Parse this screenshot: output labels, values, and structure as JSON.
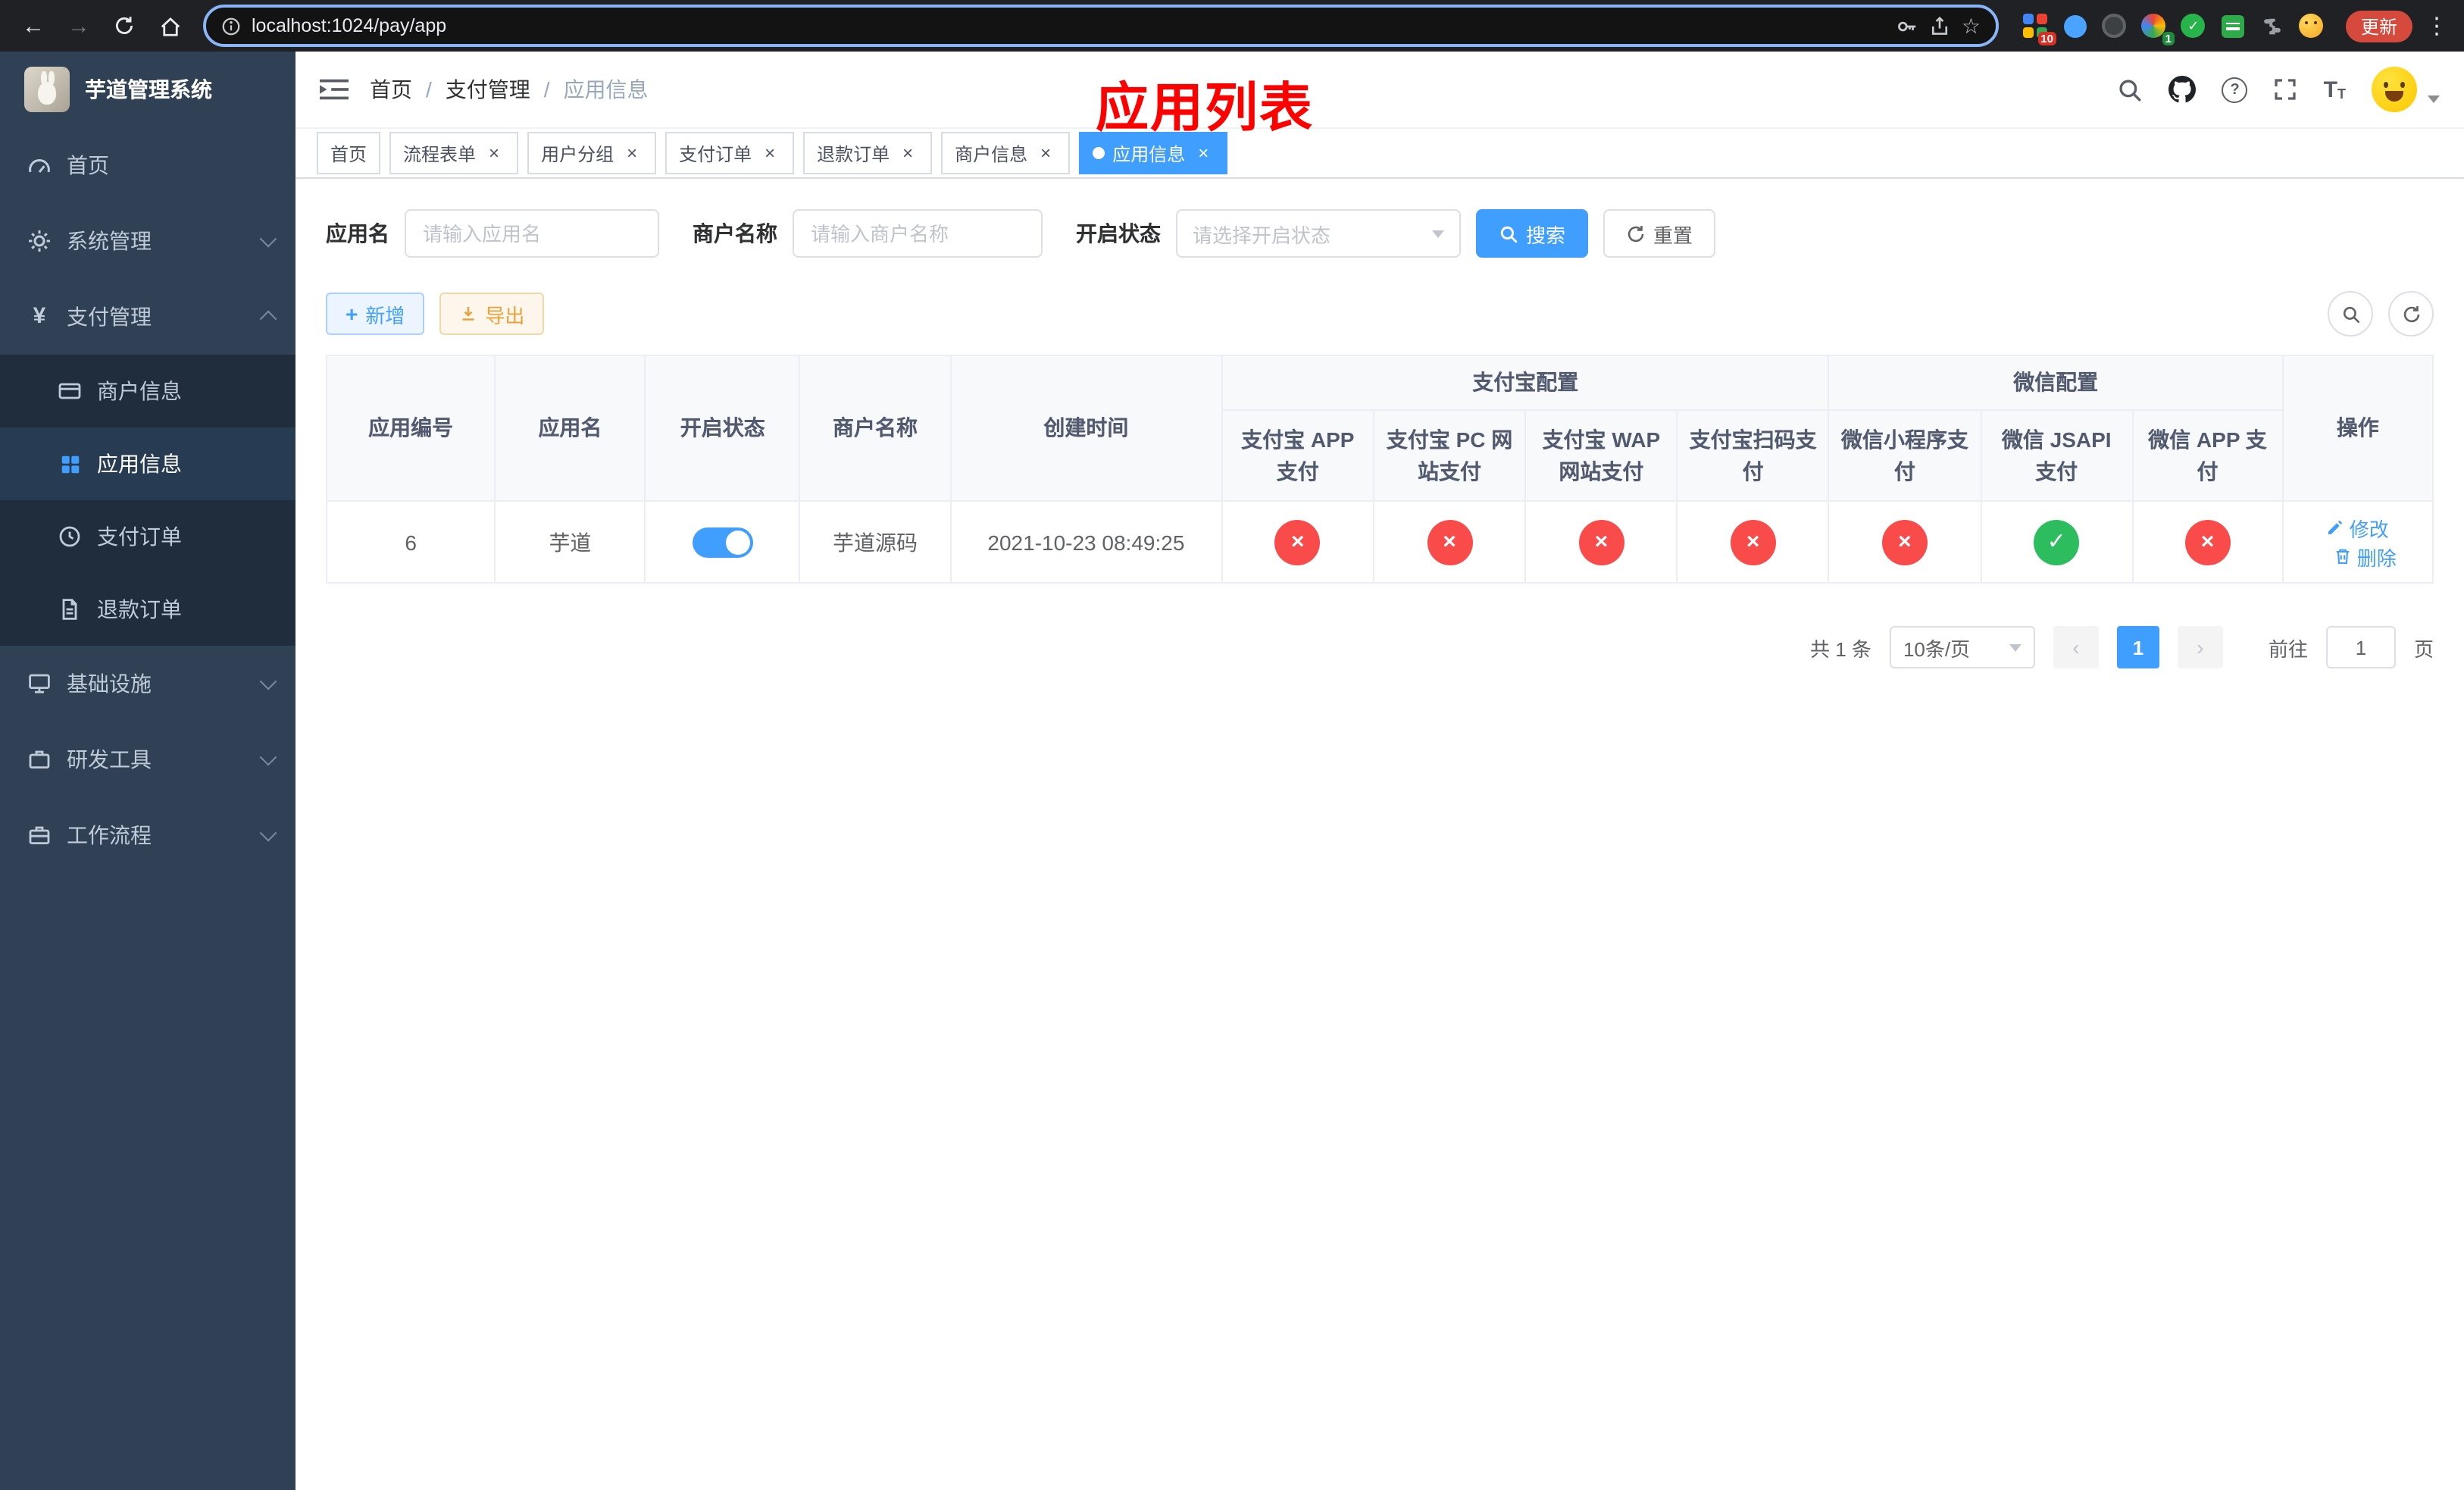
{
  "browser": {
    "url": "localhost:1024/pay/app",
    "update_button": "更新",
    "extension_badges": {
      "grid": "10",
      "avatar": "1"
    }
  },
  "sidebar": {
    "logo_title": "芋道管理系统",
    "items": {
      "home": "首页",
      "system": "系统管理",
      "payment": "支付管理",
      "infra": "基础设施",
      "dev_tools": "研发工具",
      "workflow": "工作流程"
    },
    "payment_children": {
      "merchant": "商户信息",
      "app": "应用信息",
      "order": "支付订单",
      "refund": "退款订单"
    }
  },
  "header": {
    "breadcrumb": [
      "首页",
      "支付管理",
      "应用信息"
    ],
    "overlay_title": "应用列表"
  },
  "tabs": [
    {
      "label": "首页",
      "closable": false,
      "active": false
    },
    {
      "label": "流程表单",
      "closable": true,
      "active": false
    },
    {
      "label": "用户分组",
      "closable": true,
      "active": false
    },
    {
      "label": "支付订单",
      "closable": true,
      "active": false
    },
    {
      "label": "退款订单",
      "closable": true,
      "active": false
    },
    {
      "label": "商户信息",
      "closable": true,
      "active": false
    },
    {
      "label": "应用信息",
      "closable": true,
      "active": true
    }
  ],
  "filters": {
    "app_name_label": "应用名",
    "app_name_placeholder": "请输入应用名",
    "merchant_label": "商户名称",
    "merchant_placeholder": "请输入商户名称",
    "status_label": "开启状态",
    "status_placeholder": "请选择开启状态",
    "search_button": "搜索",
    "reset_button": "重置"
  },
  "toolbar": {
    "add_label": "新增",
    "export_label": "导出"
  },
  "table": {
    "group_headers": {
      "alipay": "支付宝配置",
      "wechat": "微信配置"
    },
    "columns": [
      "应用编号",
      "应用名",
      "开启状态",
      "商户名称",
      "创建时间",
      "支付宝 APP 支付",
      "支付宝 PC 网站支付",
      "支付宝 WAP 网站支付",
      "支付宝扫码支付",
      "微信小程序支付",
      "微信 JSAPI 支付",
      "微信 APP 支付",
      "操作"
    ],
    "rows": [
      {
        "id": "6",
        "name": "芋道",
        "enabled": true,
        "merchant": "芋道源码",
        "created_at": "2021-10-23 08:49:25",
        "statuses": {
          "alipay_app": false,
          "alipay_pc": false,
          "alipay_wap": false,
          "alipay_qr": false,
          "wx_lite": false,
          "wx_jsapi": true,
          "wx_app": false
        },
        "edit_label": "修改",
        "delete_label": "删除"
      }
    ]
  },
  "pagination": {
    "total_text": "共 1 条",
    "page_size": "10条/页",
    "current_page": "1",
    "goto_label": "前往",
    "goto_value": "1",
    "page_unit": "页"
  },
  "colors": {
    "accent": "#409eff",
    "success": "#2dbd5f",
    "danger": "#fa4b4b",
    "warning": "#e6a23c",
    "sidebar_bg": "#304156",
    "submenu_bg": "#1f2d3d",
    "annotation": "#fb0200",
    "tab_active_bg": "#409eff"
  }
}
